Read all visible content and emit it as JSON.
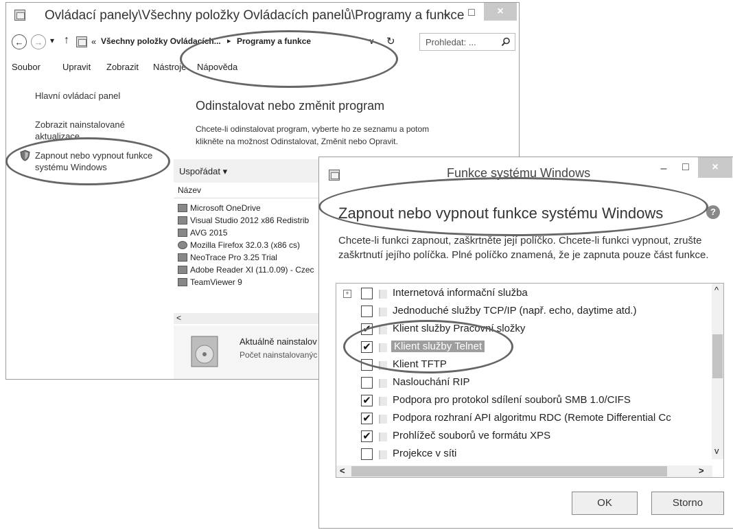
{
  "cp": {
    "title": "Ovládací panely\\Všechny položky Ovládacích panelů\\Programy a funkce",
    "minimize": "–",
    "maximize": "□",
    "close": "×",
    "back_icon": "←",
    "forward_icon": "→",
    "dropdown_icon": "▾",
    "up_icon": "↑",
    "address_prefix": "«",
    "address_part1": "Všechny položky Ovládacích...",
    "address_sep": "▸",
    "address_part2": "Programy a funkce",
    "address_dropdown": "∨",
    "refresh_icon": "↻",
    "search_placeholder": "Prohledat: ...",
    "menu": [
      "Soubor",
      "Upravit",
      "Zobrazit",
      "Nástroje",
      "Nápověda"
    ],
    "sidebar": {
      "home": "Hlavní ovládací panel",
      "updates_1": "Zobrazit nainstalované",
      "updates_2": "aktualizace",
      "features_1": "Zapnout nebo vypnout funkce",
      "features_2": "systému Windows"
    },
    "heading": "Odinstalovat nebo změnit program",
    "desc_1": "Chcete-li odinstalovat program, vyberte ho ze seznamu a potom",
    "desc_2": "klikněte na možnost Odinstalovat, Změnit nebo Opravit.",
    "organize": "Uspořádat ▾",
    "column_name": "Název",
    "programs": [
      "Microsoft OneDrive",
      "Visual Studio 2012 x86 Redistrib",
      "AVG 2015",
      "Mozilla Firefox 32.0.3 (x86 cs)",
      "NeoTrace Pro 3.25 Trial",
      "Adobe Reader XI (11.0.09) - Czec",
      "TeamViewer 9"
    ],
    "scroll_left": "<",
    "detail_title": "Aktuálně nainstalov",
    "detail_sub": "Počet nainstalovanýc"
  },
  "wf": {
    "title": "Funkce systému Windows",
    "minimize": "–",
    "maximize": "□",
    "close": "×",
    "heading": "Zapnout nebo vypnout funkce systému Windows",
    "help": "?",
    "desc": "Chcete-li funkci zapnout, zaškrtněte její políčko. Chcete-li funkci vypnout, zrušte zaškrtnutí jejího políčka. Plné políčko znamená, že je zapnuta pouze část funkce.",
    "features": [
      {
        "label": "Internetová informační služba",
        "checked": false,
        "expandable": true
      },
      {
        "label": "Jednoduché služby TCP/IP (např. echo, daytime atd.)",
        "checked": false
      },
      {
        "label": "Klient služby Pracovní složky",
        "checked": true
      },
      {
        "label": "Klient služby Telnet",
        "checked": true,
        "selected": true
      },
      {
        "label": "Klient TFTP",
        "checked": false
      },
      {
        "label": "Naslouchání RIP",
        "checked": false
      },
      {
        "label": "Podpora pro protokol sdílení souborů SMB 1.0/CIFS",
        "checked": true
      },
      {
        "label": "Podpora rozhraní API algoritmu RDC (Remote Differential Cc",
        "checked": true
      },
      {
        "label": "Prohlížeč souborů ve formátu XPS",
        "checked": true
      },
      {
        "label": "Projekce v síti",
        "checked": false
      }
    ],
    "check_mark": "✔",
    "expander": "+",
    "scroll_up": "^",
    "scroll_down": "v",
    "scroll_left": "<",
    "scroll_right": ">",
    "ok": "OK",
    "cancel": "Storno"
  }
}
